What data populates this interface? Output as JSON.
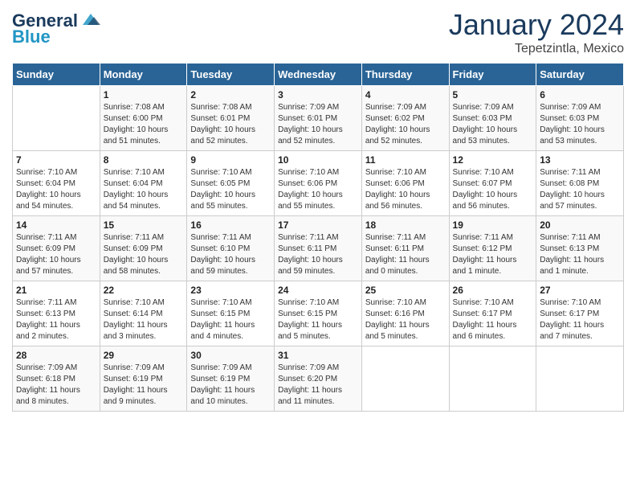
{
  "header": {
    "logo_general": "General",
    "logo_blue": "Blue",
    "month": "January 2024",
    "location": "Tepetzintla, Mexico"
  },
  "columns": [
    "Sunday",
    "Monday",
    "Tuesday",
    "Wednesday",
    "Thursday",
    "Friday",
    "Saturday"
  ],
  "weeks": [
    [
      {
        "day": "",
        "info": ""
      },
      {
        "day": "1",
        "info": "Sunrise: 7:08 AM\nSunset: 6:00 PM\nDaylight: 10 hours\nand 51 minutes."
      },
      {
        "day": "2",
        "info": "Sunrise: 7:08 AM\nSunset: 6:01 PM\nDaylight: 10 hours\nand 52 minutes."
      },
      {
        "day": "3",
        "info": "Sunrise: 7:09 AM\nSunset: 6:01 PM\nDaylight: 10 hours\nand 52 minutes."
      },
      {
        "day": "4",
        "info": "Sunrise: 7:09 AM\nSunset: 6:02 PM\nDaylight: 10 hours\nand 52 minutes."
      },
      {
        "day": "5",
        "info": "Sunrise: 7:09 AM\nSunset: 6:03 PM\nDaylight: 10 hours\nand 53 minutes."
      },
      {
        "day": "6",
        "info": "Sunrise: 7:09 AM\nSunset: 6:03 PM\nDaylight: 10 hours\nand 53 minutes."
      }
    ],
    [
      {
        "day": "7",
        "info": "Sunrise: 7:10 AM\nSunset: 6:04 PM\nDaylight: 10 hours\nand 54 minutes."
      },
      {
        "day": "8",
        "info": "Sunrise: 7:10 AM\nSunset: 6:04 PM\nDaylight: 10 hours\nand 54 minutes."
      },
      {
        "day": "9",
        "info": "Sunrise: 7:10 AM\nSunset: 6:05 PM\nDaylight: 10 hours\nand 55 minutes."
      },
      {
        "day": "10",
        "info": "Sunrise: 7:10 AM\nSunset: 6:06 PM\nDaylight: 10 hours\nand 55 minutes."
      },
      {
        "day": "11",
        "info": "Sunrise: 7:10 AM\nSunset: 6:06 PM\nDaylight: 10 hours\nand 56 minutes."
      },
      {
        "day": "12",
        "info": "Sunrise: 7:10 AM\nSunset: 6:07 PM\nDaylight: 10 hours\nand 56 minutes."
      },
      {
        "day": "13",
        "info": "Sunrise: 7:11 AM\nSunset: 6:08 PM\nDaylight: 10 hours\nand 57 minutes."
      }
    ],
    [
      {
        "day": "14",
        "info": "Sunrise: 7:11 AM\nSunset: 6:09 PM\nDaylight: 10 hours\nand 57 minutes."
      },
      {
        "day": "15",
        "info": "Sunrise: 7:11 AM\nSunset: 6:09 PM\nDaylight: 10 hours\nand 58 minutes."
      },
      {
        "day": "16",
        "info": "Sunrise: 7:11 AM\nSunset: 6:10 PM\nDaylight: 10 hours\nand 59 minutes."
      },
      {
        "day": "17",
        "info": "Sunrise: 7:11 AM\nSunset: 6:11 PM\nDaylight: 10 hours\nand 59 minutes."
      },
      {
        "day": "18",
        "info": "Sunrise: 7:11 AM\nSunset: 6:11 PM\nDaylight: 11 hours\nand 0 minutes."
      },
      {
        "day": "19",
        "info": "Sunrise: 7:11 AM\nSunset: 6:12 PM\nDaylight: 11 hours\nand 1 minute."
      },
      {
        "day": "20",
        "info": "Sunrise: 7:11 AM\nSunset: 6:13 PM\nDaylight: 11 hours\nand 1 minute."
      }
    ],
    [
      {
        "day": "21",
        "info": "Sunrise: 7:11 AM\nSunset: 6:13 PM\nDaylight: 11 hours\nand 2 minutes."
      },
      {
        "day": "22",
        "info": "Sunrise: 7:10 AM\nSunset: 6:14 PM\nDaylight: 11 hours\nand 3 minutes."
      },
      {
        "day": "23",
        "info": "Sunrise: 7:10 AM\nSunset: 6:15 PM\nDaylight: 11 hours\nand 4 minutes."
      },
      {
        "day": "24",
        "info": "Sunrise: 7:10 AM\nSunset: 6:15 PM\nDaylight: 11 hours\nand 5 minutes."
      },
      {
        "day": "25",
        "info": "Sunrise: 7:10 AM\nSunset: 6:16 PM\nDaylight: 11 hours\nand 5 minutes."
      },
      {
        "day": "26",
        "info": "Sunrise: 7:10 AM\nSunset: 6:17 PM\nDaylight: 11 hours\nand 6 minutes."
      },
      {
        "day": "27",
        "info": "Sunrise: 7:10 AM\nSunset: 6:17 PM\nDaylight: 11 hours\nand 7 minutes."
      }
    ],
    [
      {
        "day": "28",
        "info": "Sunrise: 7:09 AM\nSunset: 6:18 PM\nDaylight: 11 hours\nand 8 minutes."
      },
      {
        "day": "29",
        "info": "Sunrise: 7:09 AM\nSunset: 6:19 PM\nDaylight: 11 hours\nand 9 minutes."
      },
      {
        "day": "30",
        "info": "Sunrise: 7:09 AM\nSunset: 6:19 PM\nDaylight: 11 hours\nand 10 minutes."
      },
      {
        "day": "31",
        "info": "Sunrise: 7:09 AM\nSunset: 6:20 PM\nDaylight: 11 hours\nand 11 minutes."
      },
      {
        "day": "",
        "info": ""
      },
      {
        "day": "",
        "info": ""
      },
      {
        "day": "",
        "info": ""
      }
    ]
  ]
}
